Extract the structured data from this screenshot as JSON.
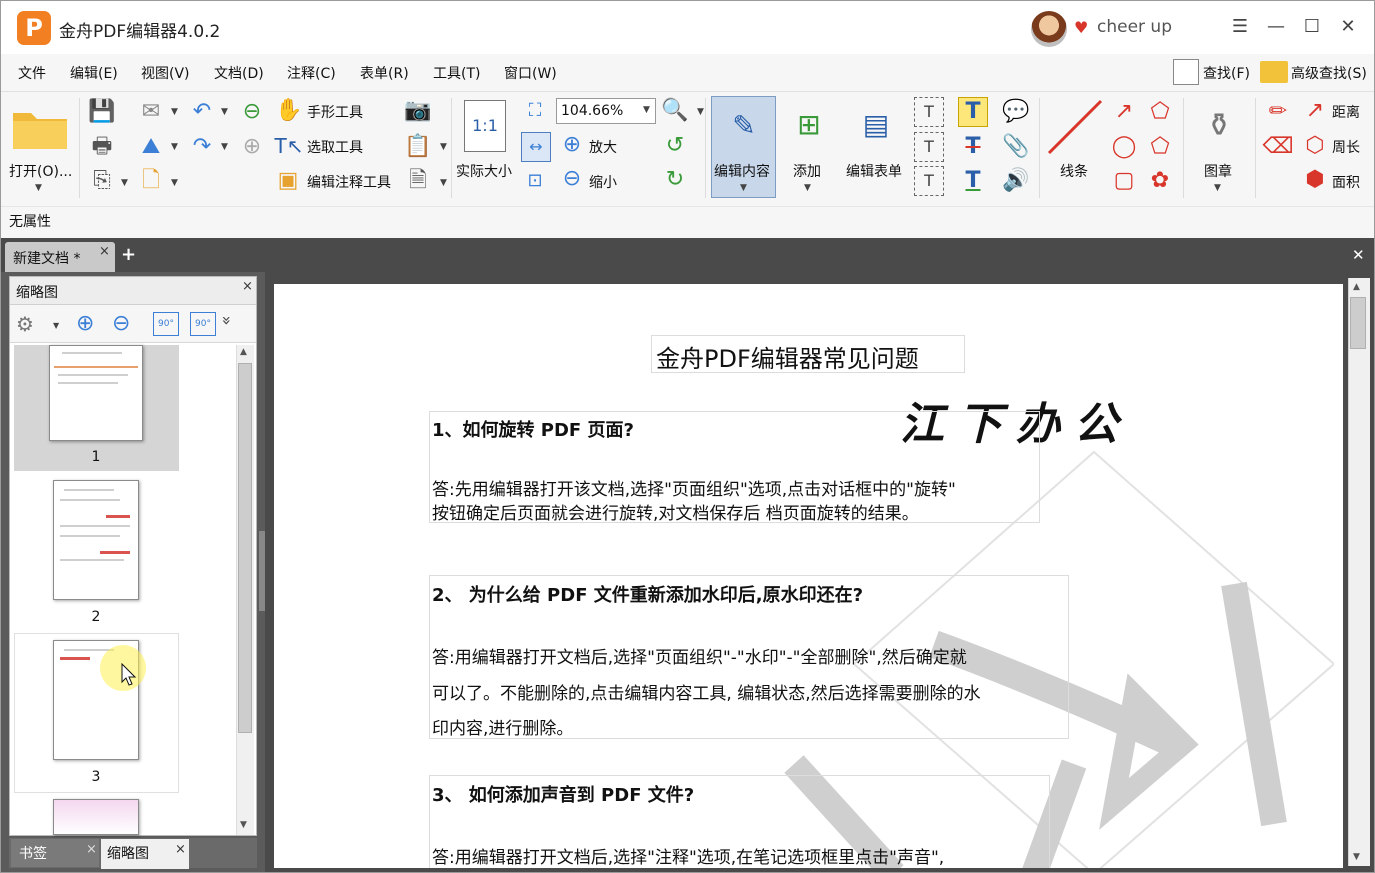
{
  "app": {
    "logo_glyph": "P",
    "title": "金舟PDF编辑器4.0.2",
    "user_name": "cheer up",
    "window_controls": {
      "menu": "☰",
      "minimize": "—",
      "maximize": "☐",
      "close": "✕"
    }
  },
  "menu": {
    "items": [
      "文件",
      "编辑(E)",
      "视图(V)",
      "文档(D)",
      "注释(C)",
      "表单(R)",
      "工具(T)",
      "窗口(W)"
    ],
    "search_label": "查找(F)",
    "advanced_search_label": "高级查找(S)"
  },
  "toolbar": {
    "open_label": "打开(O)...",
    "hand_tool": "手形工具",
    "select_tool": "选取工具",
    "edit_annotation_tool": "编辑注释工具",
    "actual_size": "实际大小",
    "actual_size_glyph": "1:1",
    "zoom_value": "104.66%",
    "zoom_in": "放大",
    "zoom_out": "缩小",
    "edit_content": "编辑内容",
    "add": "添加",
    "edit_form": "编辑表单",
    "lines": "线条",
    "stamp": "图章",
    "distance": "距离",
    "perimeter": "周长",
    "area": "面积"
  },
  "property_bar": {
    "text": "无属性"
  },
  "tabs": {
    "document_tab": "新建文档 *",
    "close_glyph": "×",
    "add_glyph": "+",
    "area_close": "✕"
  },
  "left_panel": {
    "title": "缩略图",
    "close_glyph": "×",
    "rotate_left": "90°",
    "rotate_right": "90°",
    "expand_glyph": "»",
    "pages": [
      "1",
      "2",
      "3"
    ],
    "bottom_tabs": {
      "bookmarks": "书签",
      "thumbnails": "缩略图"
    }
  },
  "document": {
    "heading": "金舟PDF编辑器常见问题",
    "signature": "江下办公",
    "q1_title": "1、如何旋转  PDF  页面?",
    "q1_answer_line1": "答:先用编辑器打开该文档,选择\"页面组织\"选项,点击对话框中的\"旋转\"",
    "q1_answer_line2": "按钮确定后页面就会进行旋转,对文档保存后  档页面旋转的结果。",
    "q2_title": "2、  为什么给  PDF  文件重新添加水印后,原水印还在?",
    "q2_answer_line1": "答:用编辑器打开文档后,选择\"页面组织\"-\"水印\"-\"全部删除\",然后确定就",
    "q2_answer_line2": "可以了。不能删除的,点击编辑内容工具,  编辑状态,然后选择需要删除的水",
    "q2_answer_line3": "印内容,进行删除。",
    "q3_title": "3、  如何添加声音到  PDF  文件?",
    "q3_answer_line1": "答:用编辑器打开文档后,选择\"注释\"选项,在笔记选项框里点击\"声音\","
  },
  "colors": {
    "logo_orange": "#f27f22",
    "tab_bar": "#4a4a4a",
    "active_tool": "#c8d8ea",
    "watermark": "#cfcfcf"
  }
}
